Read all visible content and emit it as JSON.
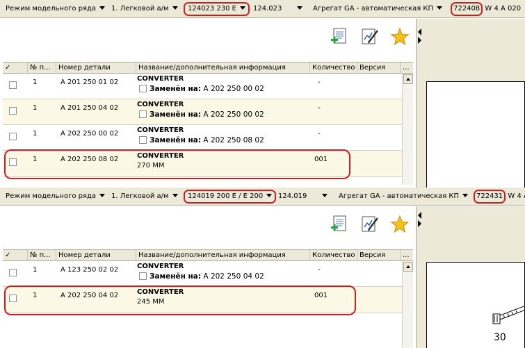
{
  "panels": [
    {
      "toolbar": {
        "mode": "Режим модельного ряда",
        "vehicle_class": "1. Легковой а/м",
        "model": "124023 230 E",
        "model_code": "124.023",
        "assembly": "Агрегат GA - автоматическая КП",
        "assembly_code": "722408",
        "assembly_extra": "W 4 A 020"
      },
      "columns": [
        "✓",
        "№ п...",
        "Номер детали",
        "Название/дополнительная информация",
        "Количество",
        "Версия",
        "..."
      ],
      "rows": [
        {
          "pos": "1",
          "part": "A 201 250 01 02",
          "name": "CONVERTER",
          "replaced_label": "Заменён на:",
          "replaced_by": "A 202 250 00 02",
          "info": "",
          "qty": "-",
          "version": ""
        },
        {
          "pos": "1",
          "part": "A 201 250 04 02",
          "name": "CONVERTER",
          "replaced_label": "Заменён на:",
          "replaced_by": "A 202 250 00 02",
          "info": "",
          "qty": "-",
          "version": ""
        },
        {
          "pos": "1",
          "part": "A 202 250 00 02",
          "name": "CONVERTER",
          "replaced_label": "Заменён на:",
          "replaced_by": "A 202 250 08 02",
          "info": "",
          "qty": "-",
          "version": ""
        },
        {
          "pos": "1",
          "part": "A 202 250 08 02",
          "name": "CONVERTER",
          "replaced_label": "",
          "replaced_by": "",
          "info": "270 MM",
          "qty": "001",
          "version": ""
        }
      ]
    },
    {
      "toolbar": {
        "mode": "Режим модельного ряда",
        "vehicle_class": "1. Легковой а/м",
        "model": "124019 200 E / E 200",
        "model_code": "124.019",
        "assembly": "Агрегат GA - автоматическая КП",
        "assembly_code": "722431",
        "assembly_extra": "W 4 A"
      },
      "columns": [
        "✓",
        "№ п...",
        "Номер детали",
        "Название/дополнительная информация",
        "Количество",
        "Версия",
        "..."
      ],
      "rows": [
        {
          "pos": "1",
          "part": "A 123 250 02 02",
          "name": "CONVERTER",
          "replaced_label": "Заменён на:",
          "replaced_by": "A 202 250 04 02",
          "info": "",
          "qty": "-",
          "version": ""
        },
        {
          "pos": "1",
          "part": "A 202 250 04 02",
          "name": "CONVERTER",
          "replaced_label": "",
          "replaced_by": "",
          "info": "245 MM",
          "qty": "001",
          "version": ""
        }
      ]
    }
  ],
  "drawing_label": "30",
  "colors": {
    "highlight": "#cc1f1f",
    "toolbar_bg": "#ece9d8",
    "row_alt": "#fbf9e6"
  },
  "icons": [
    "add-document-icon",
    "edit-document-icon",
    "favorite-star-icon",
    "dropdown-arrow-icon",
    "scroll-up-icon",
    "collapse-left-icon",
    "expand-right-icon"
  ]
}
